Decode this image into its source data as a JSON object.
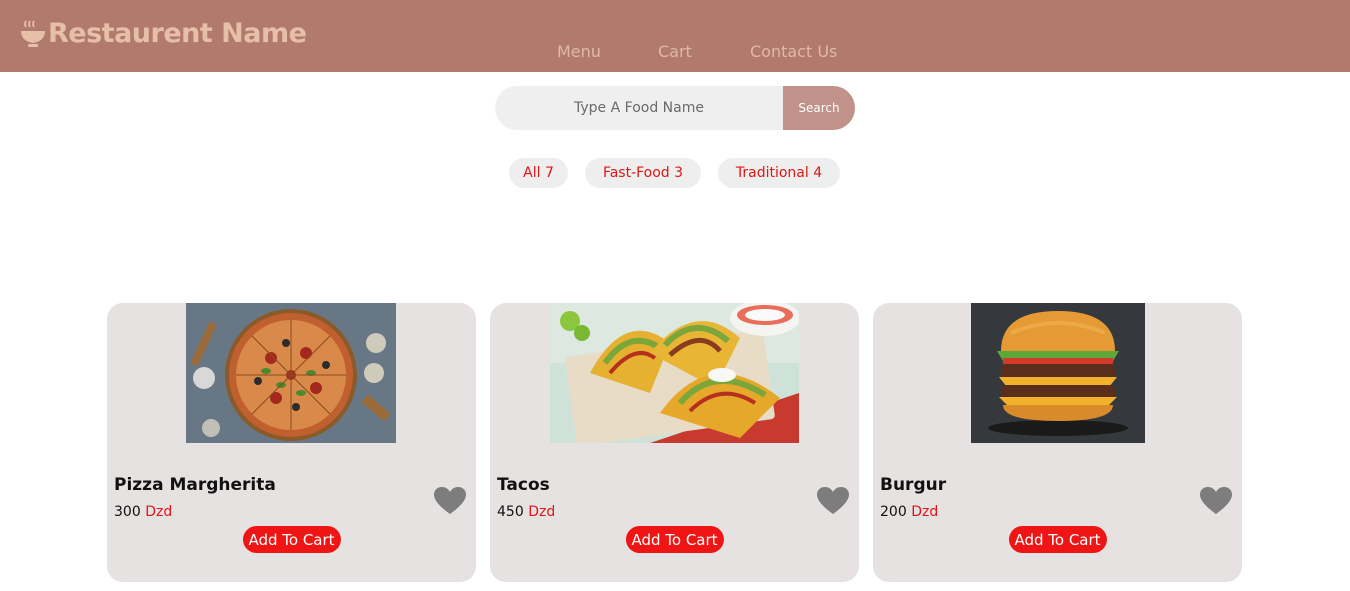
{
  "header": {
    "brand": "Restaurent Name",
    "nav": [
      "Menu",
      "Cart",
      "Contact Us"
    ],
    "bg_color": "#b27a6c"
  },
  "search": {
    "placeholder": "Type A Food Name",
    "button_label": "Search"
  },
  "filters": [
    {
      "label": "All 7"
    },
    {
      "label": "Fast-Food 3"
    },
    {
      "label": "Traditional 4"
    }
  ],
  "items": [
    {
      "name": "Pizza Margherita",
      "price": "300",
      "currency": "Dzd",
      "button": "Add To Cart",
      "image_icon": "pizza-image"
    },
    {
      "name": "Tacos",
      "price": "450",
      "currency": "Dzd",
      "button": "Add To Cart",
      "image_icon": "tacos-image"
    },
    {
      "name": "Burgur",
      "price": "200",
      "currency": "Dzd",
      "button": "Add To Cart",
      "image_icon": "burger-image"
    }
  ],
  "colors": {
    "accent": "#f01515",
    "card_bg": "#e6e2e1",
    "search_button": "#c0928a"
  }
}
